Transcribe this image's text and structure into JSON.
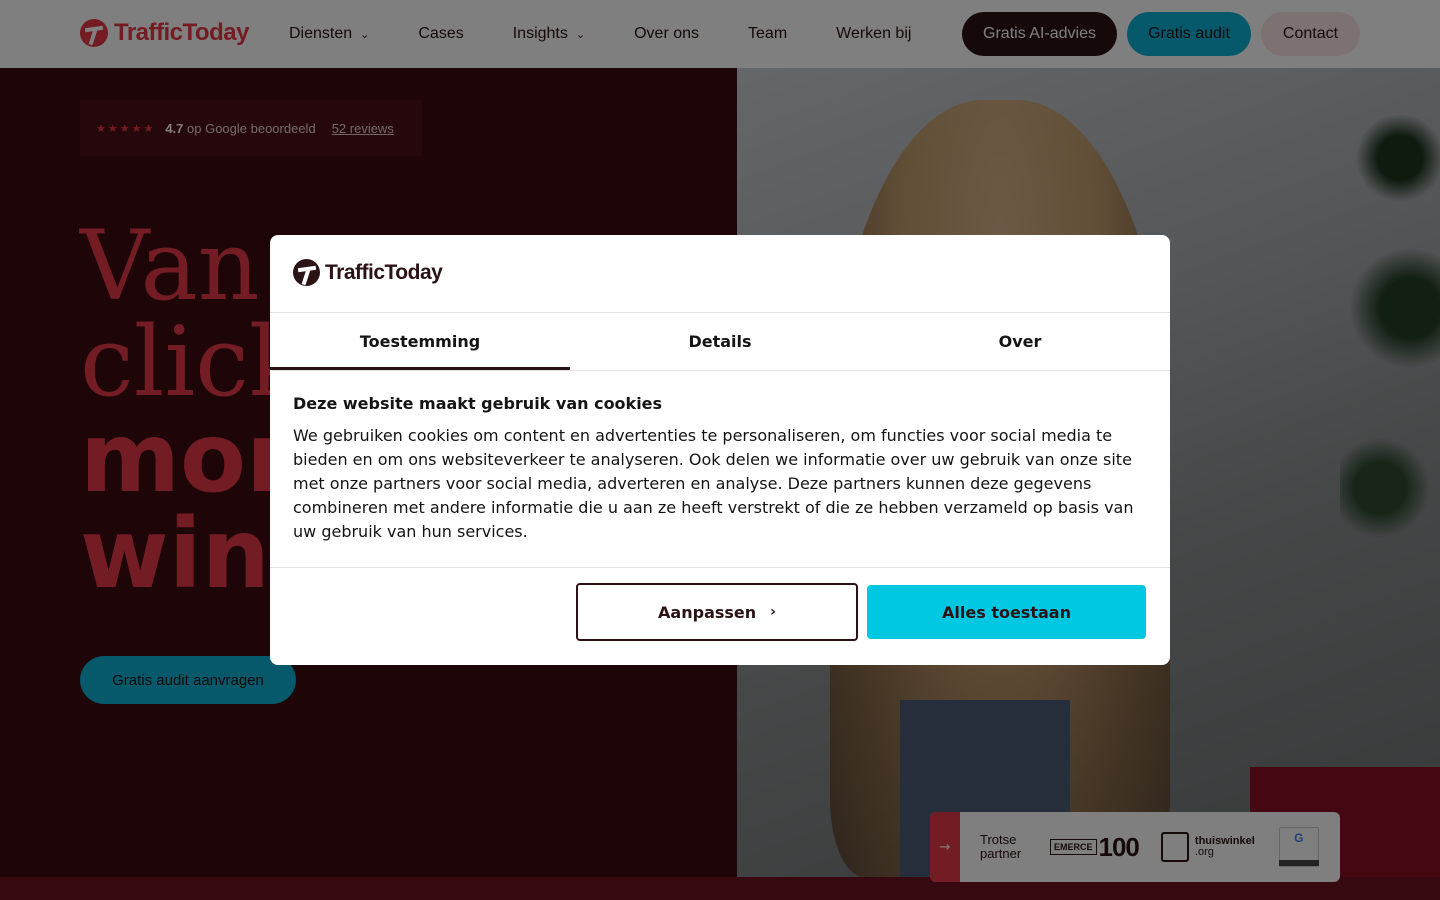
{
  "header": {
    "brand": "TrafficToday",
    "nav": [
      {
        "label": "Diensten",
        "dropdown": true
      },
      {
        "label": "Cases",
        "dropdown": false
      },
      {
        "label": "Insights",
        "dropdown": true
      },
      {
        "label": "Over ons",
        "dropdown": false
      },
      {
        "label": "Team",
        "dropdown": false
      },
      {
        "label": "Werken bij",
        "dropdown": false
      }
    ],
    "btn_ai": "Gratis AI-advies",
    "btn_audit": "Gratis audit",
    "btn_contact": "Contact"
  },
  "hero": {
    "stars": "★★★★★",
    "rating_value": "4.7",
    "rating_text": "op Google beoordeeld",
    "reviews_link": "52 reviews",
    "title_lines": [
      "Van",
      "click",
      "mor",
      "wins"
    ],
    "cta": "Gratis audit aanvragen"
  },
  "partner": {
    "label_line1": "Trotse",
    "label_line2": "partner",
    "emerce": "EMERCE",
    "emerce_num": "100",
    "thuiswinkel": "thuiswinkel",
    "thuiswinkel_sub": ".org",
    "google": "G"
  },
  "cookie": {
    "brand": "TrafficToday",
    "tabs": [
      "Toestemming",
      "Details",
      "Over"
    ],
    "active_tab": 0,
    "heading": "Deze website maakt gebruik van cookies",
    "body": "We gebruiken cookies om content en advertenties te personaliseren, om functies voor social media te bieden en om ons websiteverkeer te analyseren. Ook delen we informatie over uw gebruik van onze site met onze partners voor social media, adverteren en analyse. Deze partners kunnen deze gegevens combineren met andere informatie die u aan ze heeft verstrekt of die ze hebben verzameld op basis van uw gebruik van hun services.",
    "btn_customize": "Aanpassen",
    "btn_allow": "Alles toestaan"
  },
  "colors": {
    "brand_red": "#e63946",
    "dark": "#2a1215",
    "cyan": "#00c8e3"
  }
}
